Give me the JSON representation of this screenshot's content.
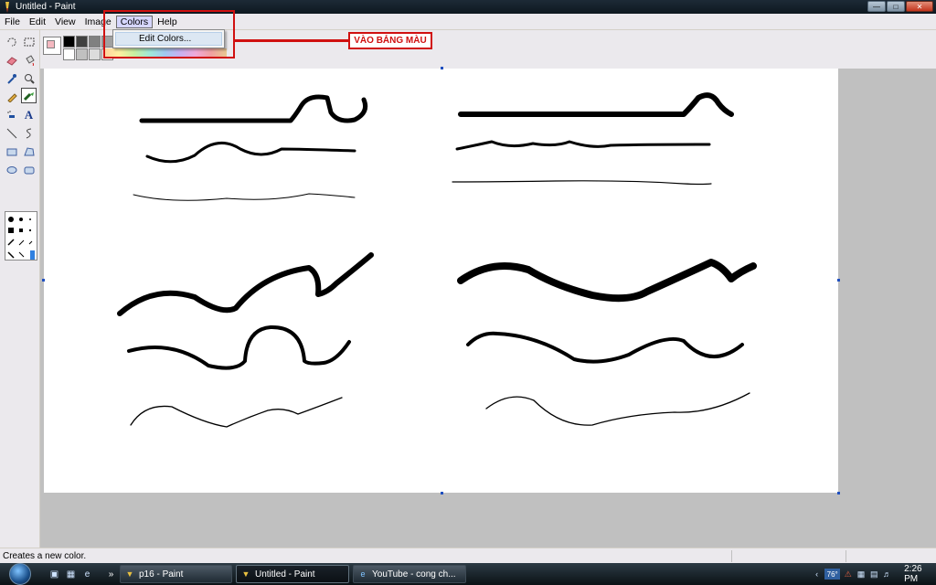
{
  "window": {
    "title": "Untitled - Paint"
  },
  "menu": {
    "items": [
      "File",
      "Edit",
      "View",
      "Image",
      "Colors",
      "Help"
    ],
    "open": {
      "label": "Colors",
      "items": [
        "Edit Colors..."
      ]
    }
  },
  "annotation": {
    "label": "VÀO BẢNG MÀU",
    "color": "#d01010"
  },
  "palette": {
    "foreground_color": "#f4b8c0",
    "background_color": "#ffffff",
    "swatches": [
      "#000000",
      "#404040",
      "#808080",
      "#a0a0a0",
      "#ffffff",
      "#c0c0c0",
      "#dcdcdc",
      "#ffffff"
    ]
  },
  "toolbox": {
    "tools": [
      "free-form-select-icon",
      "select-icon",
      "eraser-icon",
      "fill-icon",
      "pick-color-icon",
      "magnifier-icon",
      "pencil-icon",
      "brush-icon",
      "airbrush-icon",
      "text-icon",
      "line-icon",
      "curve-icon",
      "rectangle-icon",
      "polygon-icon",
      "ellipse-icon",
      "rounded-rectangle-icon"
    ],
    "selected": "brush-icon"
  },
  "status": {
    "text": "Creates a new color."
  },
  "taskbar": {
    "buttons": [
      {
        "label": "p16 - Paint",
        "icon": "paint-icon"
      },
      {
        "label": "Untitled - Paint",
        "icon": "paint-icon"
      },
      {
        "label": "YouTube - cong ch...",
        "icon": "internet-explorer-icon"
      }
    ],
    "active": "Untitled - Paint",
    "temperature": "76°",
    "clock": "2:26 PM"
  }
}
